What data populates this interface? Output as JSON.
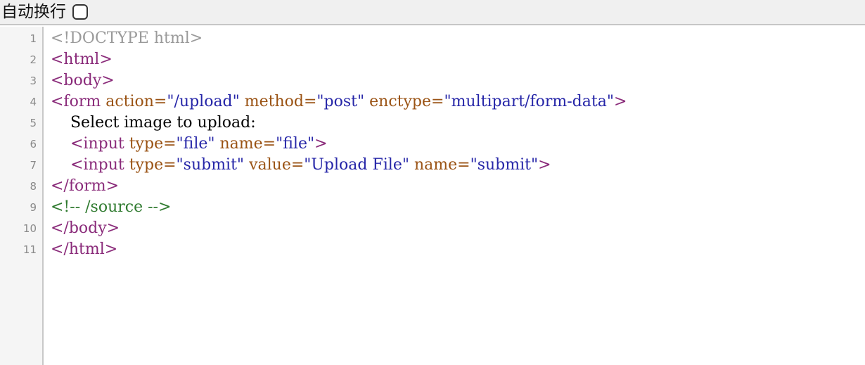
{
  "toolbar": {
    "wrap_label": "自动换行",
    "wrap_checked": false
  },
  "editor": {
    "lines": [
      {
        "no": "1",
        "tokens": [
          {
            "t": "meta",
            "v": "<!DOCTYPE html>"
          }
        ]
      },
      {
        "no": "2",
        "tokens": [
          {
            "t": "tag",
            "v": "<html>"
          }
        ]
      },
      {
        "no": "3",
        "tokens": [
          {
            "t": "tag",
            "v": "<body>"
          }
        ]
      },
      {
        "no": "4",
        "tokens": [
          {
            "t": "tag",
            "v": "<form"
          },
          {
            "t": "text",
            "v": " "
          },
          {
            "t": "attr",
            "v": "action="
          },
          {
            "t": "str",
            "v": "\"/upload\""
          },
          {
            "t": "text",
            "v": " "
          },
          {
            "t": "attr",
            "v": "method="
          },
          {
            "t": "str",
            "v": "\"post\""
          },
          {
            "t": "text",
            "v": " "
          },
          {
            "t": "attr",
            "v": "enctype="
          },
          {
            "t": "str",
            "v": "\"multipart/form-data\""
          },
          {
            "t": "tag",
            "v": ">"
          }
        ]
      },
      {
        "no": "5",
        "tokens": [
          {
            "t": "text",
            "v": "    Select image to upload:"
          }
        ]
      },
      {
        "no": "6",
        "tokens": [
          {
            "t": "text",
            "v": "    "
          },
          {
            "t": "tag",
            "v": "<input"
          },
          {
            "t": "text",
            "v": " "
          },
          {
            "t": "attr",
            "v": "type="
          },
          {
            "t": "str",
            "v": "\"file\""
          },
          {
            "t": "text",
            "v": " "
          },
          {
            "t": "attr",
            "v": "name="
          },
          {
            "t": "str",
            "v": "\"file\""
          },
          {
            "t": "tag",
            "v": ">"
          }
        ]
      },
      {
        "no": "7",
        "tokens": [
          {
            "t": "text",
            "v": "    "
          },
          {
            "t": "tag",
            "v": "<input"
          },
          {
            "t": "text",
            "v": " "
          },
          {
            "t": "attr",
            "v": "type="
          },
          {
            "t": "str",
            "v": "\"submit\""
          },
          {
            "t": "text",
            "v": " "
          },
          {
            "t": "attr",
            "v": "value="
          },
          {
            "t": "str",
            "v": "\"Upload File\""
          },
          {
            "t": "text",
            "v": " "
          },
          {
            "t": "attr",
            "v": "name="
          },
          {
            "t": "str",
            "v": "\"submit\""
          },
          {
            "t": "tag",
            "v": ">"
          }
        ]
      },
      {
        "no": "8",
        "tokens": [
          {
            "t": "tag",
            "v": "</form>"
          }
        ]
      },
      {
        "no": "9",
        "tokens": [
          {
            "t": "comment",
            "v": "<!-- /source -->"
          }
        ]
      },
      {
        "no": "10",
        "tokens": [
          {
            "t": "tag",
            "v": "</body>"
          }
        ]
      },
      {
        "no": "11",
        "tokens": [
          {
            "t": "tag",
            "v": "</html>"
          }
        ]
      }
    ]
  },
  "colors": {
    "tag": "#8a2b7a",
    "attr": "#9a5314",
    "string": "#2626a8",
    "comment": "#2f7a2f",
    "meta": "#9a9a9a",
    "text": "#000000"
  }
}
